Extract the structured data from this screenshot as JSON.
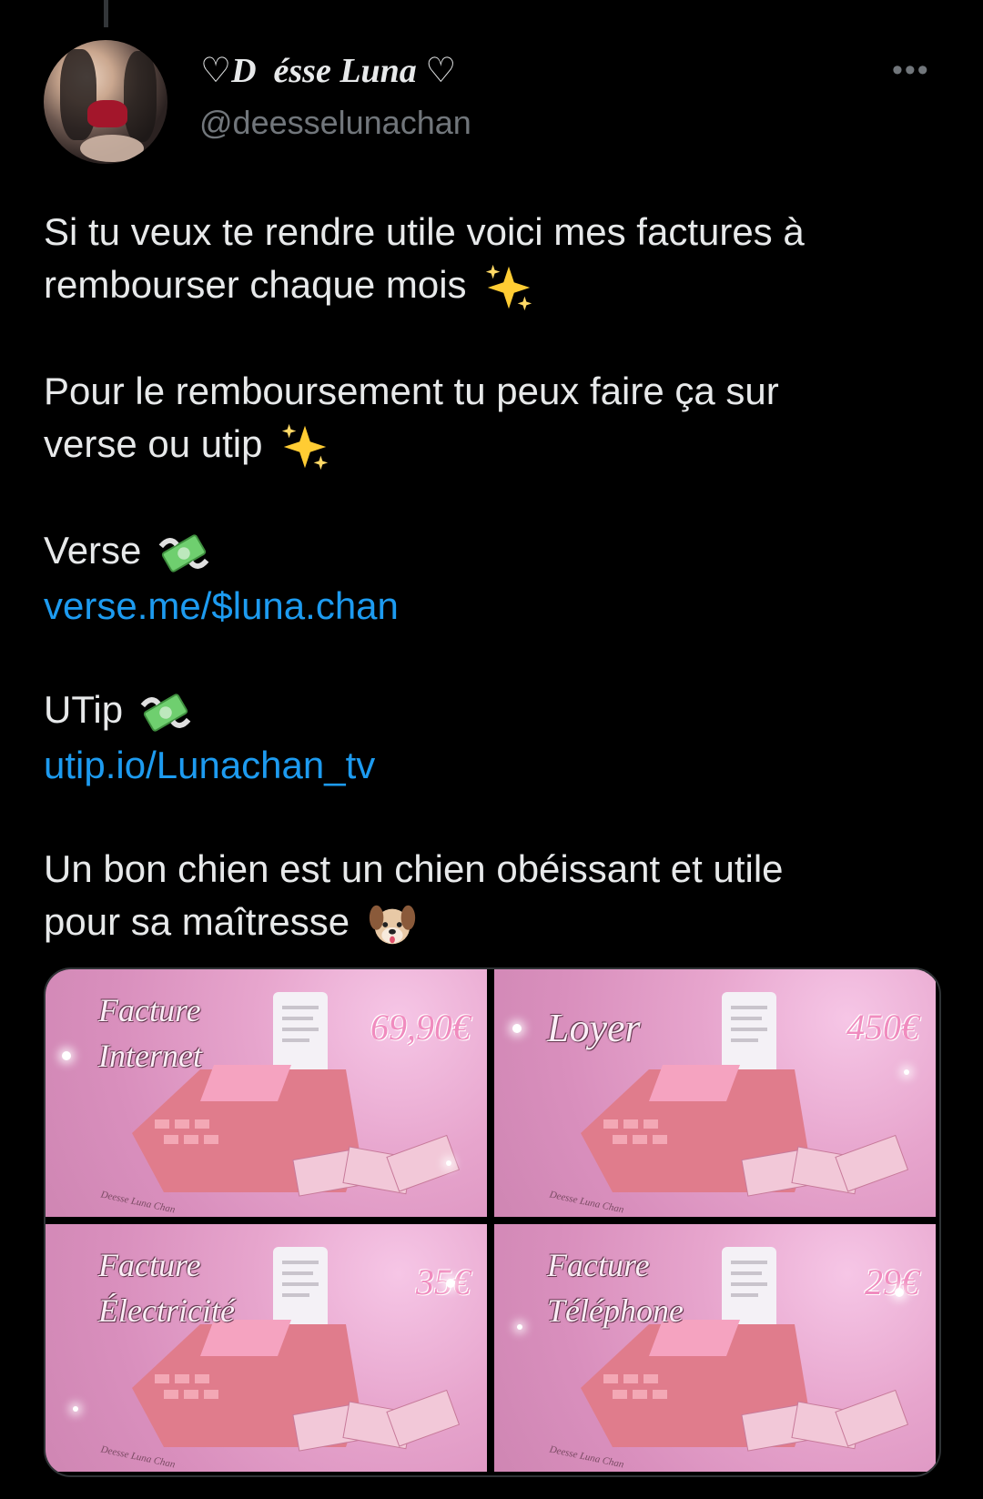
{
  "tweet": {
    "display_name": "♡D  ésse Luna ♡",
    "handle": "@deesselunachan",
    "more_label": "•••",
    "paragraphs": {
      "p1_line1": "Si tu veux te rendre utile voici mes factures à",
      "p1_line2": "rembourser chaque mois",
      "p2_line1": "Pour le remboursement tu peux faire ça sur",
      "p2_line2": "verse ou utip",
      "verse_label": "Verse",
      "verse_link": "verse.me/$luna.chan",
      "utip_label": "UTip",
      "utip_link": "utip.io/Lunachan_tv",
      "p5_line1": "Un bon chien est un chien obéissant et utile",
      "p5_line2": "pour sa maîtresse"
    },
    "emojis": [
      "sparkles-icon",
      "money-with-wings-icon",
      "dog-face-icon"
    ]
  },
  "media": {
    "tiles": [
      {
        "label_line1": "Facture",
        "label_line2": "Internet",
        "price": "69,90€",
        "watermark": "Deesse Luna Chan"
      },
      {
        "label_line1": "Loyer",
        "label_line2": "",
        "price": "450€",
        "watermark": "Deesse Luna Chan"
      },
      {
        "label_line1": "Facture",
        "label_line2": "Électricité",
        "price": "35€",
        "watermark": "Deesse Luna Chan"
      },
      {
        "label_line1": "Facture",
        "label_line2": "Téléphone",
        "price": "29€",
        "watermark": "Deesse Luna Chan"
      }
    ]
  },
  "colors": {
    "background": "#000000",
    "text": "#e7e9ea",
    "muted": "#71767b",
    "link": "#1d9bf0"
  }
}
